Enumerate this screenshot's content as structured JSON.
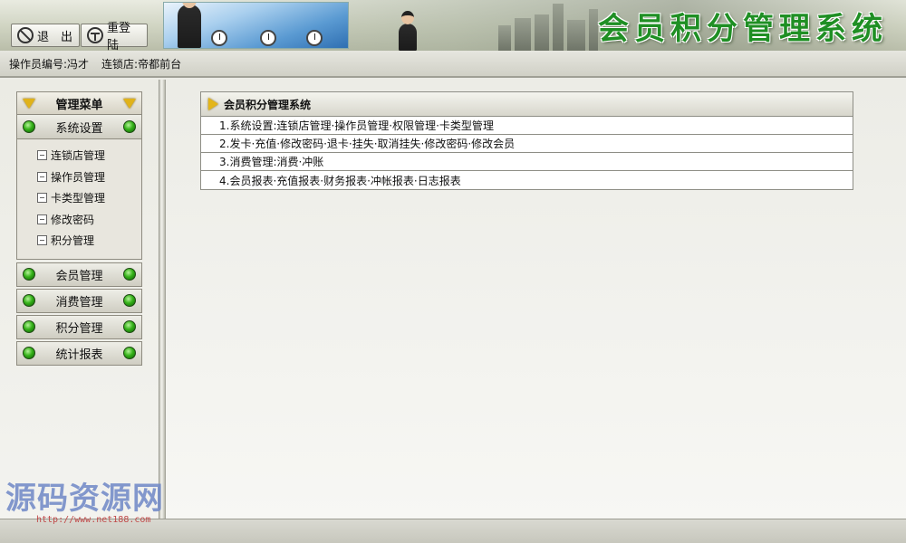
{
  "header": {
    "exit_label": "退　出",
    "relogin_label": "重登陆",
    "system_title": "会员积分管理系统"
  },
  "infobar": {
    "operator": "操作员编号:冯才",
    "store": "连锁店:帝都前台"
  },
  "nav": {
    "header_label": "管理菜单",
    "categories": [
      {
        "label": "系统设置",
        "expanded": true,
        "items": [
          "连锁店管理",
          "操作员管理",
          "卡类型管理",
          "修改密码",
          "积分管理"
        ]
      },
      {
        "label": "会员管理",
        "expanded": false
      },
      {
        "label": "消费管理",
        "expanded": false
      },
      {
        "label": "积分管理",
        "expanded": false
      },
      {
        "label": "统计报表",
        "expanded": false
      }
    ]
  },
  "panel": {
    "title": "会员积分管理系统",
    "rows": [
      "1.系统设置:连锁店管理·操作员管理·权限管理·卡类型管理",
      "2.发卡·充值·修改密码·退卡·挂失·取消挂失·修改密码·修改会员",
      "3.消费管理:消费·冲账",
      "4.会员报表·充值报表·财务报表·冲帐报表·日志报表"
    ]
  },
  "watermark": {
    "text": "源码资源网",
    "url": "http://www.net188.com"
  },
  "colors": {
    "title_green": "#1f8f24",
    "status_dot_green": "#35b219",
    "arrow_gold": "#e0b21a",
    "watermark_blue": "#6f88c7"
  },
  "icons": [
    "exit-icon",
    "relogin-icon",
    "triangle-down-icon",
    "green-dot-icon",
    "document-icon",
    "play-arrow-icon"
  ]
}
